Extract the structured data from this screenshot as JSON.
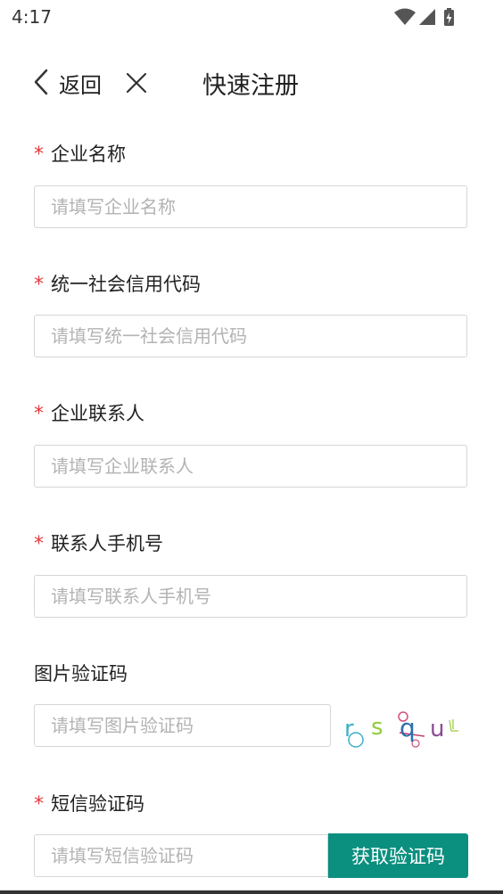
{
  "status": {
    "time": "4:17"
  },
  "nav": {
    "back_label": "返回",
    "title": "快速注册"
  },
  "form": {
    "required_mark": "*",
    "company_name": {
      "label": "企业名称",
      "placeholder": "请填写企业名称"
    },
    "credit_code": {
      "label": "统一社会信用代码",
      "placeholder": "请填写统一社会信用代码"
    },
    "contact": {
      "label": "企业联系人",
      "placeholder": "请填写企业联系人"
    },
    "phone": {
      "label": "联系人手机号",
      "placeholder": "请填写联系人手机号"
    },
    "image_captcha": {
      "label": "图片验证码",
      "placeholder": "请填写图片验证码",
      "captcha_text": "rsqul"
    },
    "sms_code": {
      "label": "短信验证码",
      "placeholder": "请填写短信验证码",
      "button_label": "获取验证码"
    }
  },
  "colors": {
    "required": "#e4393c",
    "accent": "#0b8f7f",
    "border": "#d6d6d6",
    "placeholder": "#b3b3b3"
  },
  "icons": {
    "back": "chevron-left-icon",
    "close": "close-icon",
    "wifi": "wifi-icon",
    "signal": "signal-icon",
    "battery": "battery-charging-icon"
  }
}
